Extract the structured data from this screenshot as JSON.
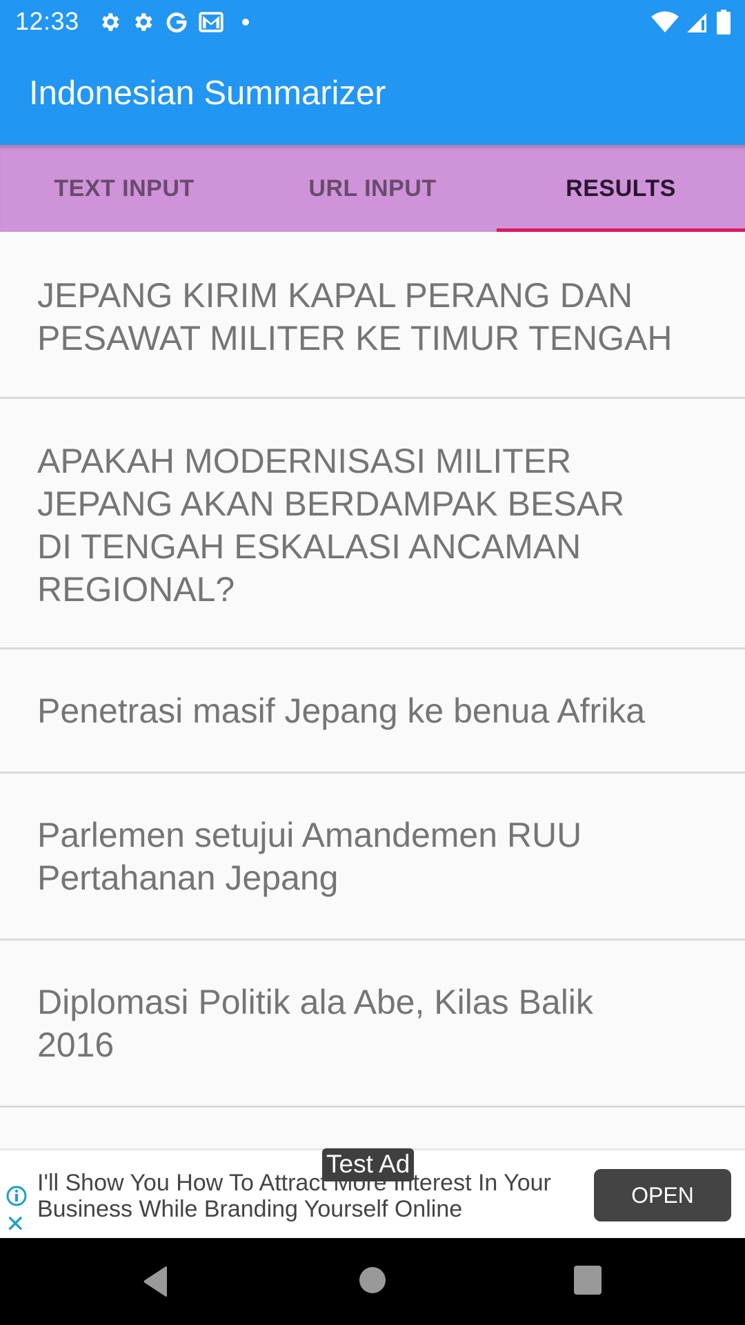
{
  "status_bar": {
    "time": "12:33",
    "left_icons": [
      "settings-icon",
      "settings-icon",
      "google-icon",
      "gmail-icon",
      "notification-dot-icon"
    ],
    "right_icons": [
      "wifi-icon",
      "cellular-signal-icon",
      "battery-icon"
    ]
  },
  "app_bar": {
    "title": "Indonesian Summarizer",
    "color": "#2196f3"
  },
  "tabs": [
    {
      "label": "TEXT INPUT",
      "active": false
    },
    {
      "label": "URL INPUT",
      "active": false
    },
    {
      "label": "RESULTS",
      "active": true
    }
  ],
  "tab_colors": {
    "background": "#ce93d8",
    "indicator": "#d81b60"
  },
  "results": [
    {
      "title": "JEPANG KIRIM KAPAL PERANG DAN PESAWAT MILITER KE TIMUR TENGAH"
    },
    {
      "title": "APAKAH MODERNISASI MILITER JEPANG AKAN BERDAMPAK BESAR DI TENGAH ESKALASI ANCAMAN REGIONAL?"
    },
    {
      "title": "Penetrasi masif Jepang ke benua Afrika"
    },
    {
      "title": "Parlemen setujui Amandemen RUU Pertahanan Jepang"
    },
    {
      "title": "Diplomasi Politik ala Abe, Kilas Balik 2016"
    }
  ],
  "ad": {
    "badge": "Test Ad",
    "text": "I'll Show You How To Attract More Interest In Your Business While Branding Yourself Online",
    "button_label": "OPEN",
    "info_icon": "info-icon",
    "close_icon": "close-icon",
    "close_glyph": "✕"
  },
  "nav_bar": {
    "buttons": [
      "back-icon",
      "home-icon",
      "recents-icon"
    ]
  }
}
